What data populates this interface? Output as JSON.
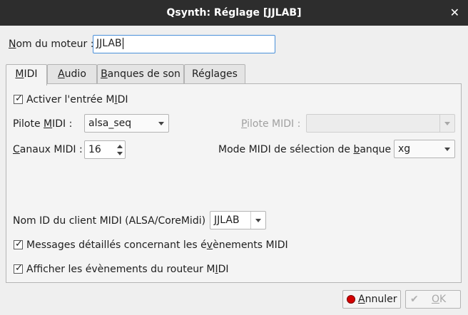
{
  "window": {
    "title": "Qsynth: Réglage [JJLAB]",
    "close_icon": "close-icon"
  },
  "engine": {
    "label_pre": "",
    "label_u": "N",
    "label_post": "om du moteur :",
    "value": "JJLAB"
  },
  "tabs": [
    {
      "label_pre": "",
      "label_u": "M",
      "label_post": "IDI",
      "active": true
    },
    {
      "label_pre": "",
      "label_u": "A",
      "label_post": "udio",
      "active": false
    },
    {
      "label_pre": "",
      "label_u": "B",
      "label_post": "anques de son",
      "active": false
    },
    {
      "label_pre": "Régla",
      "label_u": "g",
      "label_post": "es",
      "active": false
    }
  ],
  "midi": {
    "enable_input": {
      "pre": "Activer l'entrée M",
      "u": "I",
      "post": "DI",
      "checked": true
    },
    "driver": {
      "pre": "Pilote ",
      "u": "M",
      "post": "IDI :",
      "value": "alsa_seq"
    },
    "driver2": {
      "pre": "",
      "u": "P",
      "post": "ilote MIDI :",
      "value": ""
    },
    "channels": {
      "pre": "",
      "u": "C",
      "post": "anaux MIDI :",
      "value": "16"
    },
    "bank_mode": {
      "pre": "Mode MIDI de sélection de ",
      "u": "b",
      "post": "anque :",
      "value": "xg"
    },
    "client_id": {
      "label": "Nom ID du client MIDI (ALSA/CoreMidi) :",
      "value": "JJLAB"
    },
    "verbose": {
      "pre": "Messages détaillés concernant les é",
      "u": "v",
      "post": "ènements MIDI",
      "checked": true
    },
    "router_events": {
      "pre": "Afficher les évènements du routeur M",
      "u": "I",
      "post": "DI",
      "checked": true
    }
  },
  "buttons": {
    "cancel": {
      "pre": "",
      "u": "A",
      "post": "nnuler",
      "icon": "cancel-icon"
    },
    "ok": {
      "pre": "",
      "u": "O",
      "post": "K",
      "icon": "ok-icon",
      "enabled": false
    }
  },
  "colors": {
    "titlebar": "#2d2d2d",
    "focus": "#4a90d9",
    "cancel_dot": "#d40000"
  }
}
